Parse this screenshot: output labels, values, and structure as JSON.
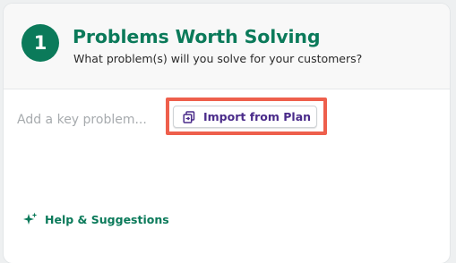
{
  "section": {
    "step_number": "1",
    "title": "Problems Worth Solving",
    "subtitle": "What problem(s) will you solve for your customers?"
  },
  "input": {
    "placeholder": "Add a key problem..."
  },
  "import_button": {
    "label": "Import from Plan",
    "icon": "copy-import-icon"
  },
  "help": {
    "label": "Help & Suggestions",
    "icon": "sparkle-icon"
  },
  "colors": {
    "brand_green": "#0b7a5a",
    "button_text_purple": "#4a2b8a",
    "highlight_red": "#ee5f4c",
    "placeholder_gray": "#a7abae"
  }
}
